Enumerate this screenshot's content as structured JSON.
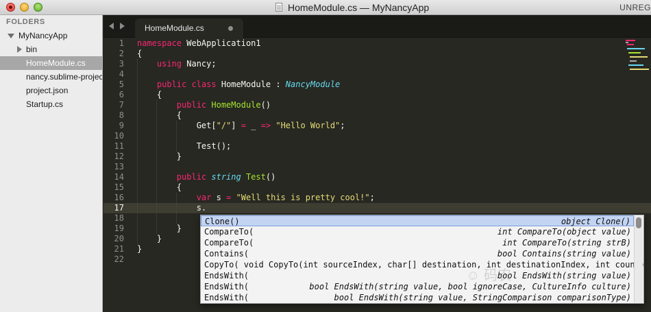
{
  "window": {
    "title": "HomeModule.cs — MyNancyApp",
    "unregistered": "UNREG"
  },
  "sidebar": {
    "header": "FOLDERS",
    "root": "MyNancyApp",
    "items": [
      {
        "label": "bin"
      },
      {
        "label": "HomeModule.cs"
      },
      {
        "label": "nancy.sublime-project"
      },
      {
        "label": "project.json"
      },
      {
        "label": "Startup.cs"
      }
    ]
  },
  "tab": {
    "label": "HomeModule.cs"
  },
  "editor": {
    "line_numbers": [
      "1",
      "2",
      "3",
      "4",
      "5",
      "6",
      "7",
      "8",
      "9",
      "10",
      "11",
      "12",
      "13",
      "14",
      "15",
      "16",
      "17",
      "18",
      "19",
      "20",
      "21",
      "22"
    ],
    "current_line": 17,
    "code": {
      "l1": {
        "kw": "namespace",
        "rest": " WebApplication1"
      },
      "l2": "{",
      "l3": {
        "indent": "    ",
        "kw": "using",
        "rest": " Nancy;"
      },
      "l5": {
        "indent": "    ",
        "kw1": "public",
        "kw2": " class",
        "name": " HomeModule",
        "sep": " : ",
        "base": "NancyModule"
      },
      "l6": "    {",
      "l7": {
        "indent": "        ",
        "kw": "public",
        "fn": " HomeModule",
        "rest": "()"
      },
      "l8": "        {",
      "l9": {
        "indent": "            ",
        "a": "Get[",
        "s1": "\"/\"",
        "b": "] ",
        "eq": "=",
        "c": " _ ",
        "arrow": "=>",
        "d": " ",
        "s2": "\"Hello World\"",
        "e": ";"
      },
      "l11": "            Test();",
      "l12": "        }",
      "l14": {
        "indent": "        ",
        "kw": "public",
        "ty": " string",
        "fn": " Test",
        "rest": "()"
      },
      "l15": "        {",
      "l16": {
        "indent": "            ",
        "kw": "var",
        "a": " s ",
        "eq": "=",
        "b": " ",
        "s": "\"Well this is pretty cool!\"",
        "c": ";"
      },
      "l17": "            s.",
      "l19": "        }",
      "l20": "    }",
      "l21": "}"
    }
  },
  "autocomplete": {
    "rows": [
      {
        "left": "Clone()",
        "right": "object Clone()"
      },
      {
        "left": "CompareTo(",
        "right": "int CompareTo(object value)"
      },
      {
        "left": "CompareTo(",
        "right": "int CompareTo(string strB)"
      },
      {
        "left": "Contains(",
        "right": "bool Contains(string value)"
      },
      {
        "left": "CopyTo( void CopyTo(int sourceIndex, char[] destination, int destinationIndex, int count)",
        "right": ""
      },
      {
        "left": "EndsWith(",
        "right": "bool EndsWith(string value)"
      },
      {
        "left": "EndsWith(",
        "right": "bool EndsWith(string value, bool ignoreCase, CultureInfo culture)"
      },
      {
        "left": "EndsWith(",
        "right": "bool EndsWith(string value, StringComparison comparisonType)"
      }
    ],
    "selected_index": 0
  },
  "watermark": "☺ 码农",
  "colors": {
    "keyword": "#f92672",
    "type": "#66d9ef",
    "function": "#a6e22e",
    "string": "#e6db74",
    "background": "#272822"
  }
}
